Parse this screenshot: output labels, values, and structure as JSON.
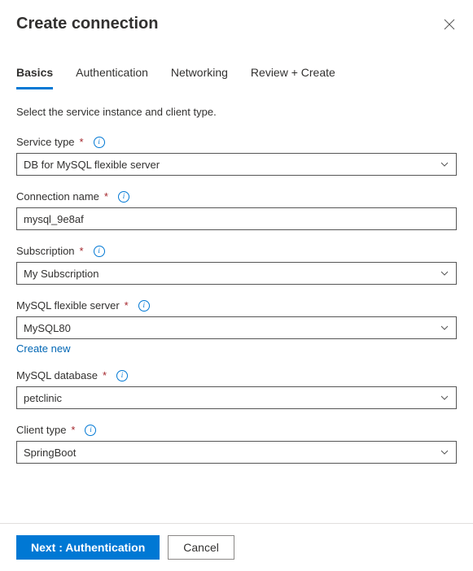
{
  "header": {
    "title": "Create connection"
  },
  "tabs": [
    {
      "label": "Basics",
      "active": true
    },
    {
      "label": "Authentication",
      "active": false
    },
    {
      "label": "Networking",
      "active": false
    },
    {
      "label": "Review + Create",
      "active": false
    }
  ],
  "intro": "Select the service instance and client type.",
  "fields": {
    "service_type": {
      "label": "Service type",
      "value": "DB for MySQL flexible server"
    },
    "connection_name": {
      "label": "Connection name",
      "value": "mysql_9e8af"
    },
    "subscription": {
      "label": "Subscription",
      "value": "My Subscription"
    },
    "mysql_server": {
      "label": "MySQL flexible server",
      "value": "MySQL80",
      "create_new": "Create new"
    },
    "mysql_database": {
      "label": "MySQL database",
      "value": "petclinic"
    },
    "client_type": {
      "label": "Client type",
      "value": "SpringBoot"
    }
  },
  "footer": {
    "next": "Next : Authentication",
    "cancel": "Cancel"
  }
}
